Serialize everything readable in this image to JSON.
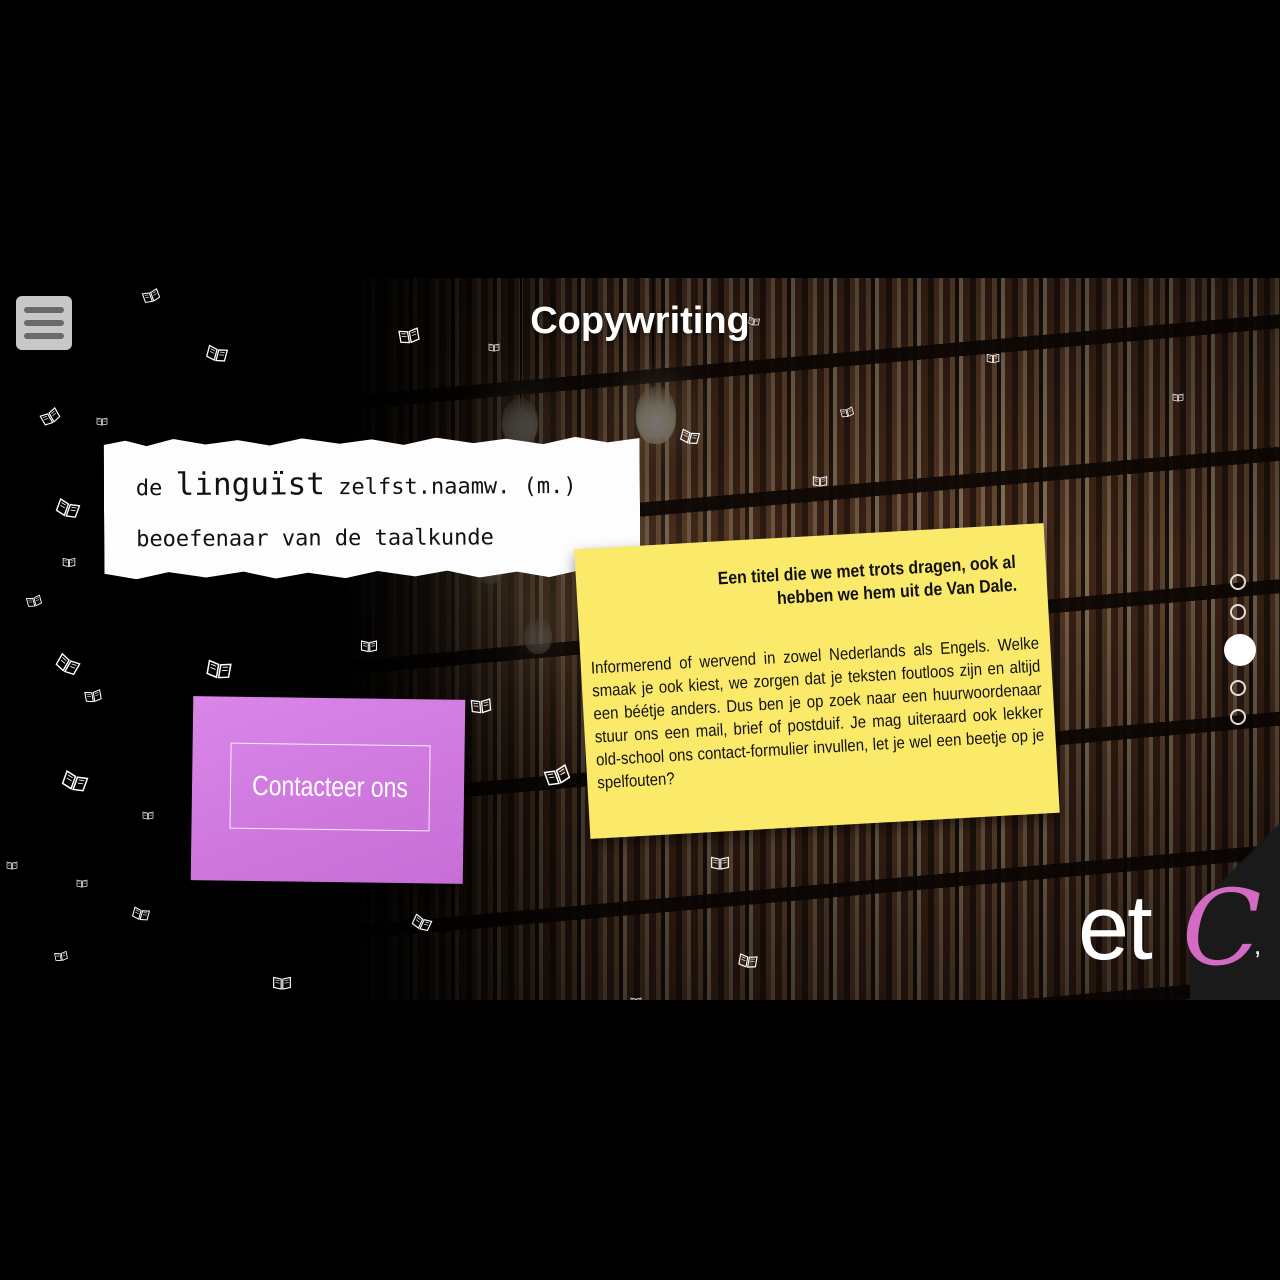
{
  "header": {
    "title": "Copywriting",
    "menu_icon": "hamburger-menu-icon"
  },
  "definition": {
    "article": "de",
    "word": "linguïst",
    "grammar": "zelfst.naamw. (m.)",
    "meaning": "beoefenaar van de taalkunde"
  },
  "note": {
    "heading_line1": "Een titel die we met trots dragen, ook al",
    "heading_line2": "hebben we hem uit de Van Dale.",
    "body": "Informerend of wervend in zowel Nederlands als Engels. Welke smaak je ook kiest, we zorgen dat je teksten foutloos zijn en altijd een béétje anders. Dus ben je op zoek naar een huurwoordenaar stuur ons een mail, brief of postduif. Je mag uiteraard ook lekker old-school ons contact-formulier invullen, let je wel een beetje op je spelfouten?"
  },
  "contact": {
    "label": "Contacteer ons"
  },
  "pagination": {
    "count": 5,
    "active_index": 3
  },
  "logo": {
    "text_et": "et",
    "text_c": "C",
    "text_comma": ","
  },
  "colors": {
    "yellow_note": "#fbe96a",
    "pink_note": "#d47fe4",
    "logo_accent": "#d36ac3",
    "menu_button": "#c8c8c8"
  },
  "decor_icon": "flying-book-icon"
}
